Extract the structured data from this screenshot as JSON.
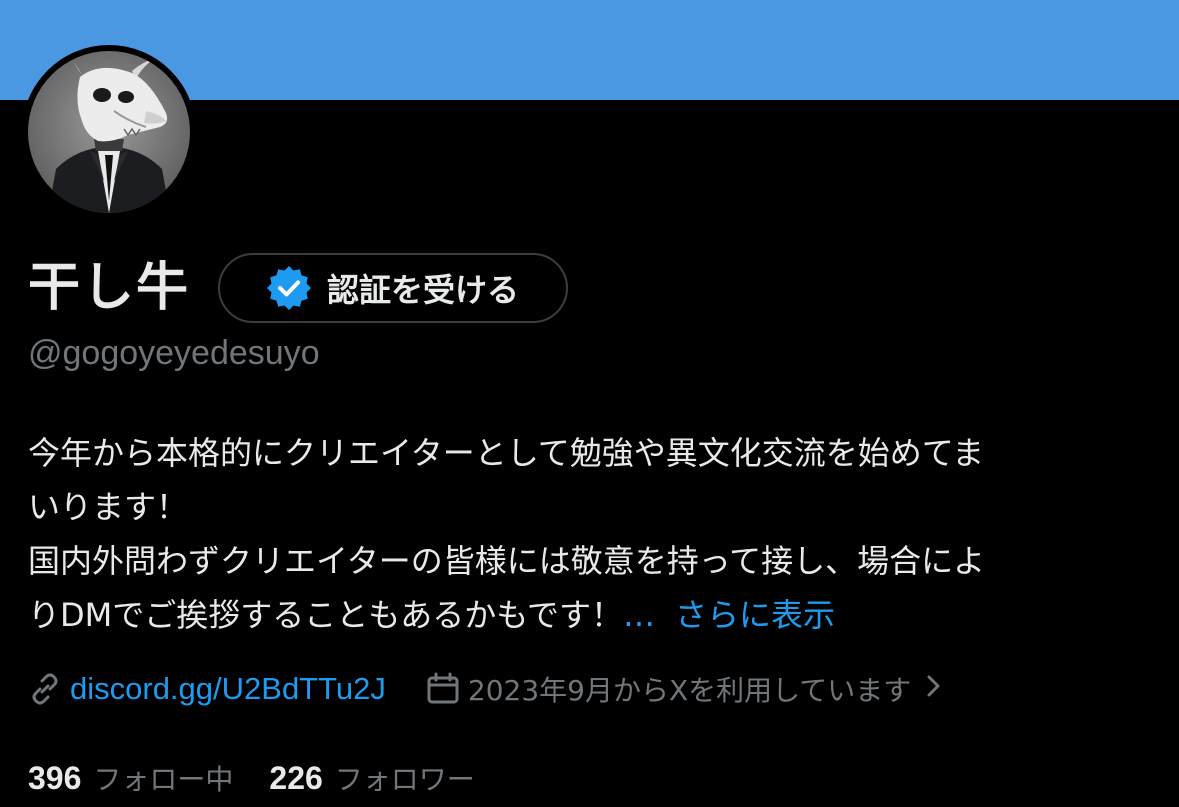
{
  "profile": {
    "display_name": "干し牛",
    "handle": "@gogoyeyedesuyo",
    "verify_button_label": "認証を受ける",
    "bio_lines": [
      "今年から本格的にクリエイターとして勉強や異文化交流を始めてま",
      "いります！",
      "国内外問わずクリエイターの皆様には敬意を持って接し、場合によ",
      "りDMでご挨拶することもあるかもです！"
    ],
    "bio_ellipsis": "…",
    "show_more_label": "さらに表示",
    "link_text": "discord.gg/U2BdTTu2J",
    "joined_text": "2023年9月からXを利用しています",
    "following_count": "396",
    "following_label": "フォロー中",
    "followers_count": "226",
    "followers_label": "フォロワー"
  },
  "colors": {
    "banner": "#4a97e2",
    "background": "#000000",
    "accent": "#1d9bf0",
    "text_primary": "#e7e9ea",
    "text_secondary": "#71767b",
    "button_border": "#3a3d41"
  },
  "icons": {
    "verified_badge": "verified-badge-icon",
    "link": "link-icon",
    "calendar": "calendar-icon",
    "chevron": "chevron-right-icon"
  }
}
